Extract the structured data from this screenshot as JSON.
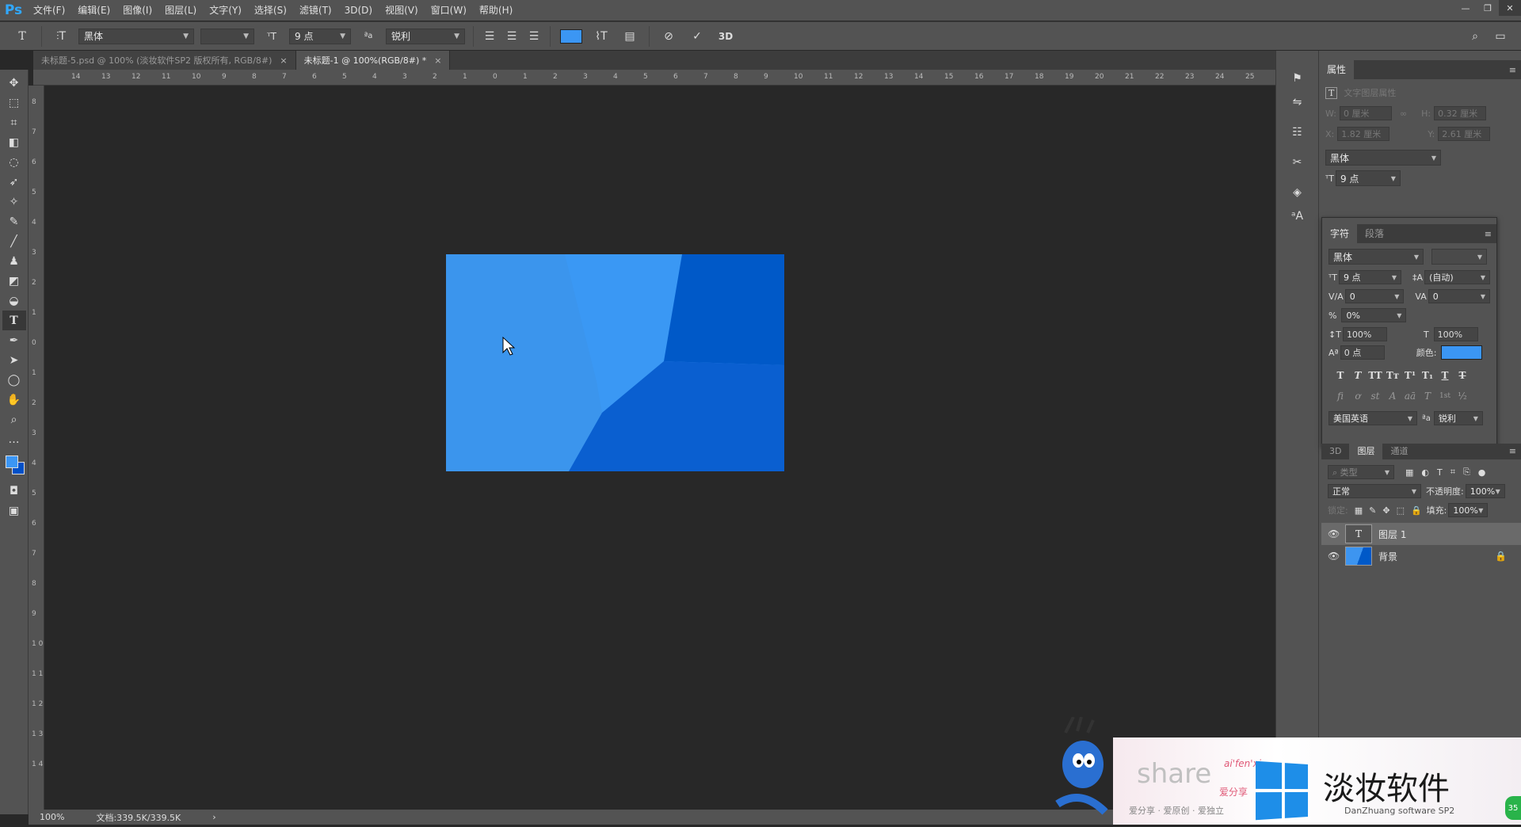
{
  "app": {
    "logo": "Ps"
  },
  "menu": [
    "文件(F)",
    "编辑(E)",
    "图像(I)",
    "图层(L)",
    "文字(Y)",
    "选择(S)",
    "滤镜(T)",
    "3D(D)",
    "视图(V)",
    "窗口(W)",
    "帮助(H)"
  ],
  "options": {
    "font_family": "黑体",
    "font_size": "9 点",
    "anti_alias": "锐利",
    "three_d": "3D",
    "text_color": "#3b96f4"
  },
  "tabs": [
    {
      "label": "未标题-5.psd @ 100% (淡妆软件SP2 版权所有, RGB/8#)"
    },
    {
      "label": "未标题-1 @ 100%(RGB/8#) *"
    }
  ],
  "ruler_top": [
    "14",
    "13",
    "12",
    "11",
    "10",
    "9",
    "8",
    "7",
    "6",
    "5",
    "4",
    "3",
    "2",
    "1",
    "0",
    "1",
    "2",
    "3",
    "4",
    "5",
    "6",
    "7",
    "8",
    "9",
    "10",
    "11",
    "12",
    "13",
    "14",
    "15",
    "16",
    "17",
    "18",
    "19",
    "20",
    "21",
    "22",
    "23",
    "24",
    "25"
  ],
  "ruler_left": [
    "8",
    "7",
    "6",
    "5",
    "4",
    "3",
    "2",
    "1",
    "0",
    "1",
    "2",
    "3",
    "4",
    "5",
    "6",
    "7",
    "8",
    "9",
    "1 0",
    "1 1",
    "1 2",
    "1 3",
    "1 4"
  ],
  "status": {
    "zoom": "100%",
    "doc": "文档:339.5K/339.5K"
  },
  "properties": {
    "tab": "属性",
    "title": "文字图层属性",
    "w_label": "W:",
    "w_value": "0 厘米",
    "h_label": "H:",
    "h_value": "0.32 厘米",
    "x_label": "X:",
    "x_value": "1.82 厘米",
    "y_label": "Y:",
    "y_value": "2.61 厘米",
    "font": "黑体",
    "size": "9 点"
  },
  "character": {
    "tabs": [
      "字符",
      "段落"
    ],
    "font": "黑体",
    "size": "9 点",
    "leading": "(自动)",
    "kerning": "0",
    "tracking": "0",
    "scale_pct": "0%",
    "v_scale": "100%",
    "h_scale": "100%",
    "baseline": "0 点",
    "color_label": "颜色:",
    "color": "#3b96f4",
    "style_buttons": [
      "T",
      "T",
      "TT",
      "Tт",
      "T¹",
      "T₁",
      "T",
      "T"
    ],
    "otf_buttons": [
      "fi",
      "ơ",
      "st",
      "A",
      "aā",
      "T",
      "1st",
      "½"
    ],
    "language": "美国英语",
    "aa": "锐利"
  },
  "layers": {
    "tabs": [
      "3D",
      "图层",
      "通道"
    ],
    "filter": "类型",
    "blend": "正常",
    "opacity_label": "不透明度:",
    "opacity": "100%",
    "lock_label": "锁定:",
    "fill_label": "填充:",
    "fill": "100%",
    "items": [
      {
        "name": "图层 1",
        "type": "text"
      },
      {
        "name": "背景",
        "type": "image"
      }
    ]
  },
  "watermark": {
    "share": "share",
    "script": "ai'fen'xi",
    "sub": "爱分享",
    "line2": "爱分享 · 爱原创 · 爱独立",
    "brand": "淡妆软件",
    "brand_en": "DanZhuang software SP2",
    "badge": "35"
  }
}
